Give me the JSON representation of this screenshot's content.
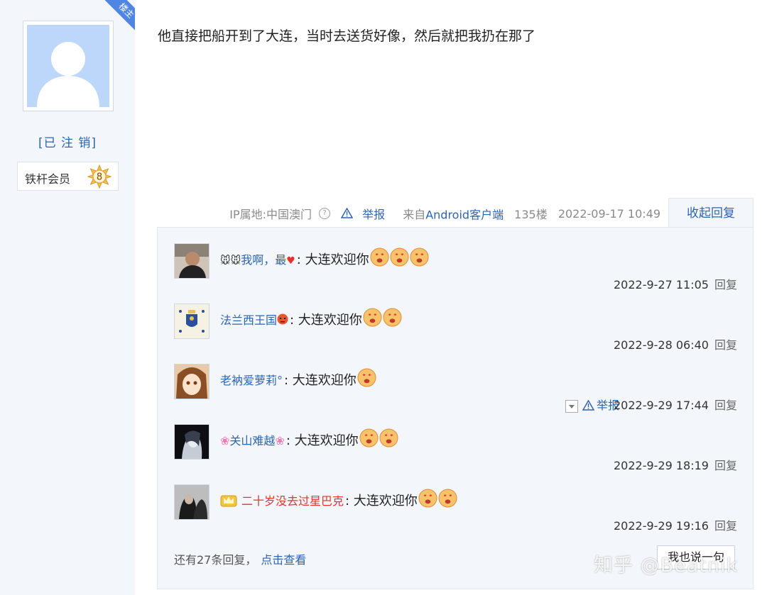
{
  "post": {
    "ribbon_label": "楼主",
    "author": "[已 注 销]",
    "member_title": "铁杆会员",
    "member_level": "8",
    "content": "他直接把船开到了大连，当时去送货好像，然后就把我扔在那了"
  },
  "meta": {
    "ip": "IP属地:中国澳门",
    "help_icon": "?",
    "report": "举报",
    "source_prefix": "来自",
    "source": "Android客户端",
    "floor": "135楼",
    "time": "2022-09-17 10:49",
    "collapse": "收起回复"
  },
  "replies": [
    {
      "name": "我啊，最",
      "content": ": 大连欢迎你",
      "time": "2022-9-27 11:05",
      "reply": "回复",
      "emojis": 3
    },
    {
      "name": "法兰西王国",
      "content": ": 大连欢迎你",
      "time": "2022-9-28 06:40",
      "reply": "回复",
      "emojis": 2
    },
    {
      "name": "老衲爱萝莉°",
      "content": ": 大连欢迎你",
      "time": "2022-9-29 17:44",
      "reply": "回复",
      "report": "举报",
      "emojis": 1
    },
    {
      "name": "关山难越",
      "content": ": 大连欢迎你",
      "time": "2022-9-29 18:19",
      "reply": "回复",
      "emojis": 2
    },
    {
      "name": "二十岁没去过星巴克",
      "content": ": 大连欢迎你",
      "time": "2022-9-29 19:16",
      "reply": "回复",
      "emojis": 2
    }
  ],
  "footer": {
    "more_text": "还有27条回复，",
    "more_link": "点击查看",
    "say_button": "我也说一句"
  },
  "watermark": "知乎 @Beatnik",
  "colors": {
    "link": "#2d64b3",
    "panel_bg": "#f3f6fa",
    "ribbon": "#4f86e3",
    "vip_name": "#e0342f"
  }
}
